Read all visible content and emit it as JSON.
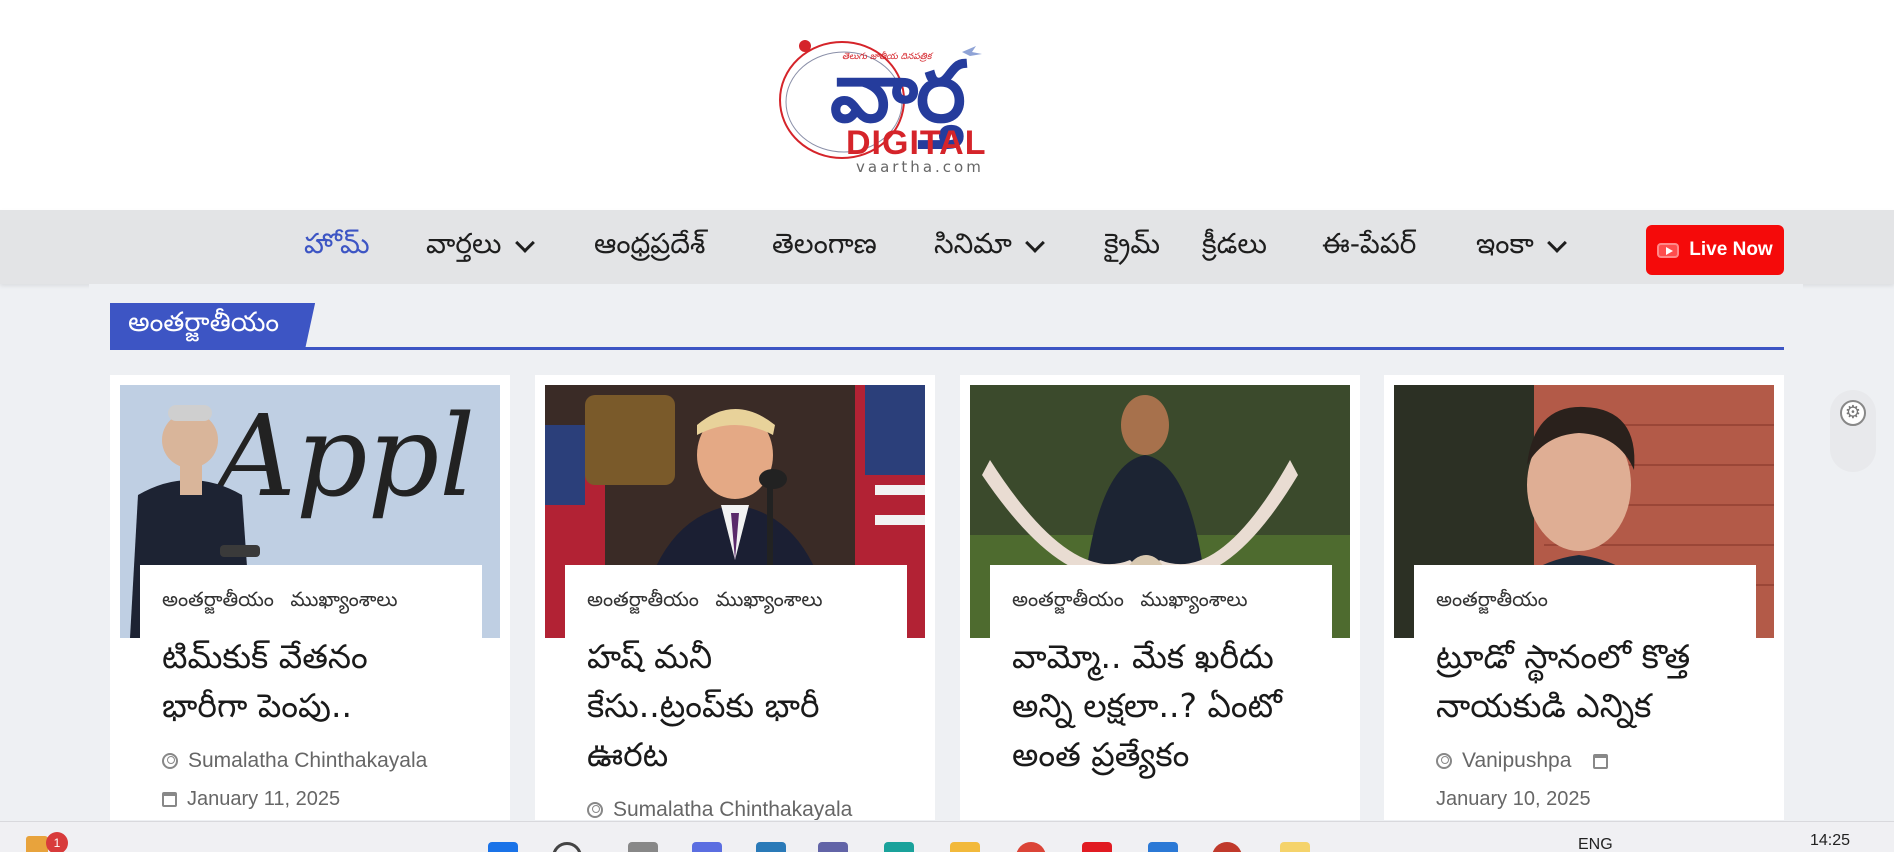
{
  "header": {
    "logo": {
      "tagline": "తెలుగు జాతీయ దినపత్రిక",
      "word": "వార్త",
      "digital": "DIGITAL",
      "domain": "vaartha.com"
    }
  },
  "nav": {
    "items": [
      {
        "label": "హోమ్",
        "active": true,
        "dropdown": false
      },
      {
        "label": "వార్తలు",
        "active": false,
        "dropdown": true
      },
      {
        "label": "ఆంధ్రప్రదేశ్",
        "active": false,
        "dropdown": false
      },
      {
        "label": "తెలంగాణ",
        "active": false,
        "dropdown": false
      },
      {
        "label": "సినిమా",
        "active": false,
        "dropdown": true
      },
      {
        "label": "క్రైమ్",
        "active": false,
        "dropdown": false
      },
      {
        "label": "క్రీడలు",
        "active": false,
        "dropdown": false
      },
      {
        "label": "ఈ-పేపర్",
        "active": false,
        "dropdown": false
      },
      {
        "label": "ఇంకా",
        "active": false,
        "dropdown": true
      }
    ],
    "live_button": "Live Now"
  },
  "section": {
    "title": "అంతర్జాతీయం"
  },
  "articles": [
    {
      "categories": [
        "అంతర్జాతీయం",
        "ముఖ్యాంశాలు"
      ],
      "title": "టిమ్‌కుక్ వేతనం భారీగా పెంపు..",
      "author": "Sumalatha Chinthakayala",
      "date": "January 11, 2025",
      "image_text": "Appl"
    },
    {
      "categories": [
        "అంతర్జాతీయం",
        "ముఖ్యాంశాలు"
      ],
      "title": "హష్ మనీ కేసు..ట్రంప్‌కు భారీ ఊరట",
      "author": "Sumalatha Chinthakayala",
      "date": ""
    },
    {
      "categories": [
        "అంతర్జాతీయం",
        "ముఖ్యాంశాలు"
      ],
      "title": "వామ్మో.. మేక ఖరీదు అన్ని లక్షలా..? ఏంటో అంత ప్రత్యేకం",
      "author": "",
      "date": ""
    },
    {
      "categories": [
        "అంతర్జాతీయం"
      ],
      "title": "ట్రూడో స్థానంలో కొత్త నాయకుడి ఎన్నిక",
      "author": "Vanipushpa",
      "date": "January 10, 2025"
    }
  ],
  "taskbar": {
    "notification_count": "1",
    "language": "ENG",
    "time": "14:25"
  },
  "colors": {
    "brand_blue": "#3d55c4",
    "live_red": "#f50a0a",
    "logo_red": "#d5242a",
    "logo_blue": "#253c9c"
  }
}
